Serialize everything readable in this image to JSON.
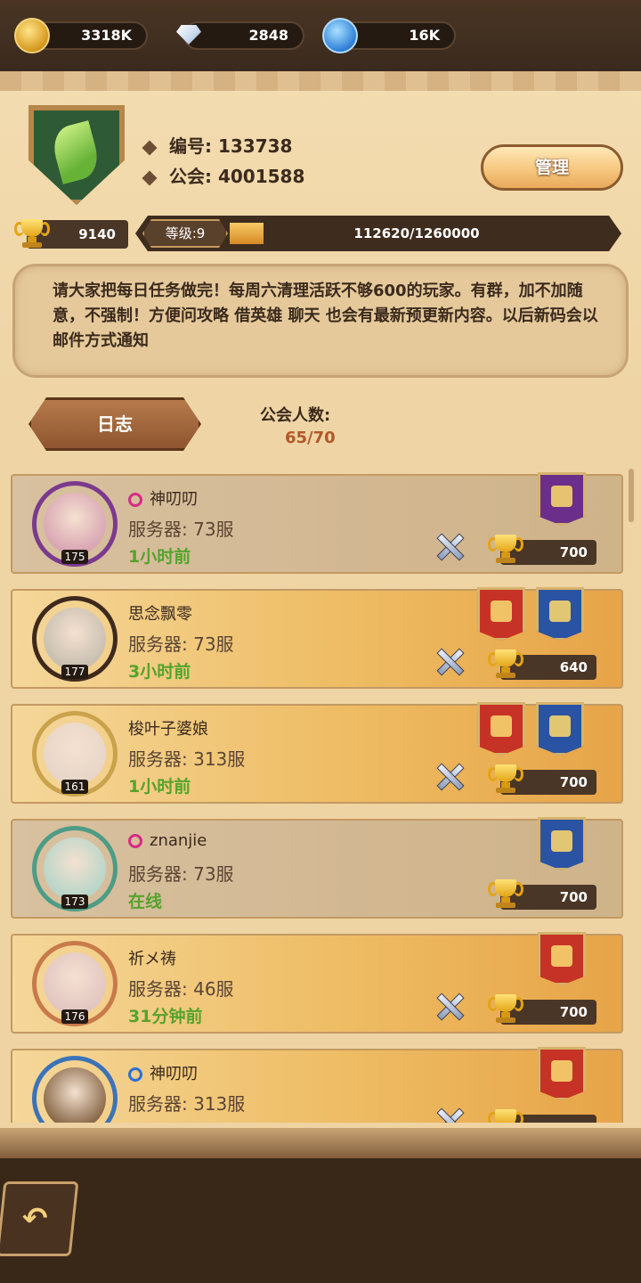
{
  "resources": [
    {
      "icon": "gold-coin-icon",
      "value": "3318K"
    },
    {
      "icon": "diamond-icon",
      "value": "2848"
    },
    {
      "icon": "crystal-icon",
      "value": "16K"
    }
  ],
  "guild": {
    "id_label": "编号: 133738",
    "guild_label": "公会: 4001588",
    "manage_label": "管理",
    "trophies": "9140",
    "level_label": "等级:9",
    "exp_text": "112620/1260000",
    "exp_fraction": 0.0894,
    "notice": "请大家把每日任务做完！每周六清理活跃不够600的玩家。有群，加不加随意，不强制！方便问攻略 借英雄 聊天 也会有最新预更新内容。以后新码会以邮件方式通知",
    "log_label": "日志",
    "member_count_label": "公会人数:",
    "member_count": "65/70"
  },
  "members": [
    {
      "name": "神叨叨",
      "gender": "female",
      "server": "服务器: 73服",
      "status": "1小时前",
      "level": "175",
      "score": "700",
      "banners": [
        "purple"
      ],
      "style": "plain"
    },
    {
      "name": "思念飘零",
      "gender": "",
      "server": "服务器: 73服",
      "status": "3小时前",
      "level": "177",
      "score": "640",
      "banners": [
        "red",
        "blue"
      ],
      "style": "gold"
    },
    {
      "name": "梭叶子婆娘",
      "gender": "",
      "server": "服务器: 313服",
      "status": "1小时前",
      "level": "161",
      "score": "700",
      "banners": [
        "red",
        "blue"
      ],
      "style": "gold"
    },
    {
      "name": "znanjie",
      "gender": "female",
      "server": "服务器: 73服",
      "status": "在线",
      "level": "173",
      "score": "700",
      "banners": [
        "blue"
      ],
      "style": "plain"
    },
    {
      "name": "祈メ祷",
      "gender": "",
      "server": "服务器: 46服",
      "status": "31分钟前",
      "level": "176",
      "score": "700",
      "banners": [
        "red"
      ],
      "style": "gold"
    },
    {
      "name": "神叨叨",
      "gender": "male",
      "server": "服务器: 313服",
      "status": "",
      "level": "",
      "score": "",
      "banners": [
        "red"
      ],
      "style": "gold"
    }
  ]
}
